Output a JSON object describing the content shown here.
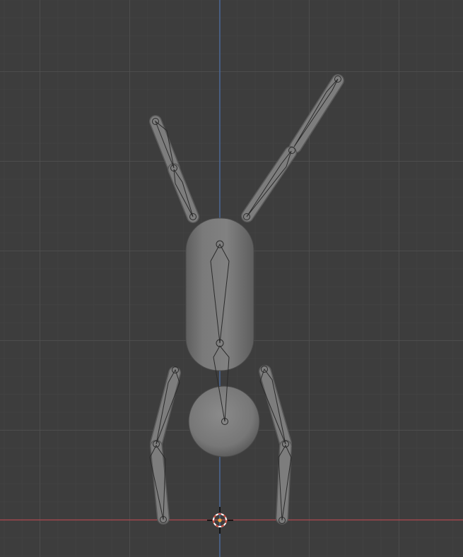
{
  "viewport": {
    "mode": "3d-viewport-front-orthographic",
    "background": "#3d3d3d",
    "grid_color": "#555555",
    "axis_colors": {
      "z_axis": "#4a6ea8",
      "x_axis": "#b0484f"
    }
  },
  "scene": {
    "mesh_color": "#7d7d7d",
    "armature_outline": "#222222",
    "cursor_colors": [
      "#ffffff",
      "#d0483a",
      "#f2a13a"
    ],
    "parts": [
      "body",
      "head",
      "left-upper-arm",
      "left-forearm",
      "right-upper-arm",
      "right-forearm",
      "left-thigh",
      "left-shin",
      "right-thigh",
      "right-shin"
    ],
    "bones": [
      "spine",
      "neck",
      "upper-arm-l",
      "forearm-l",
      "upper-arm-r",
      "forearm-r",
      "thigh-l",
      "shin-l",
      "thigh-r",
      "shin-r"
    ],
    "icons": [
      "3d-cursor-icon"
    ]
  }
}
